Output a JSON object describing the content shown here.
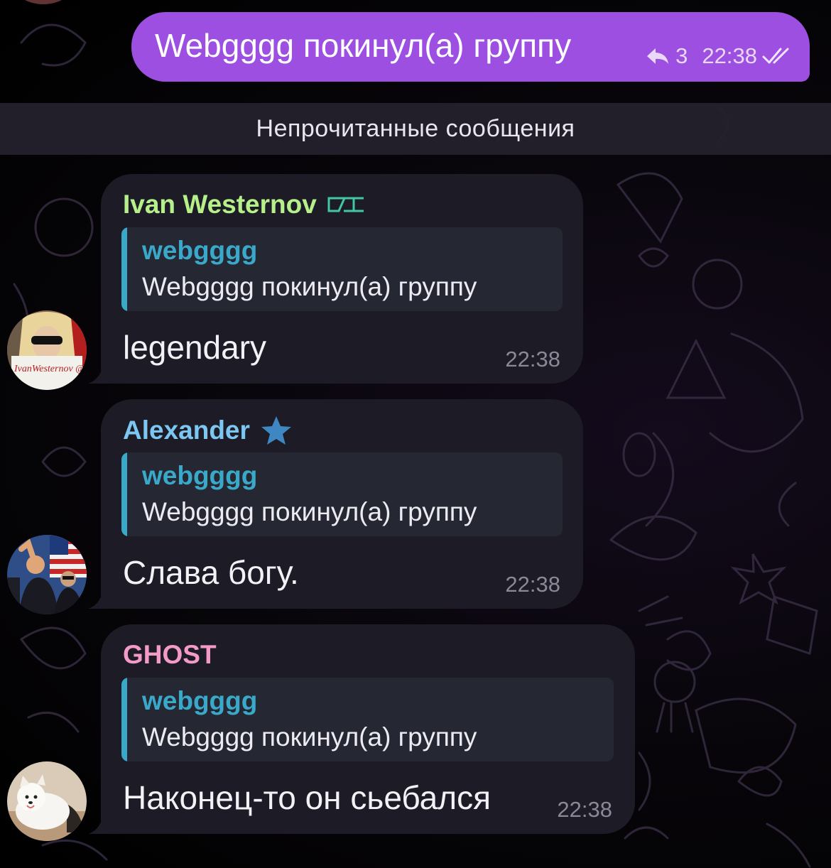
{
  "outgoing": {
    "text": "Webgggg покинул(а) группу",
    "reply_count": "3",
    "time": "22:38",
    "status_icon": "double-check-icon",
    "color": "#9c4fe0"
  },
  "unread_divider": "Непрочитанные сообщения",
  "messages": [
    {
      "sender": "Ivan Westernov",
      "sender_color": "#b5f08b",
      "emoji_status": "tag-icon",
      "quote_name": "webgggg",
      "quote_text": "Webgggg покинул(а) группу",
      "text": "legendary",
      "time": "22:38",
      "avatar_caption": "IvanWesternov @zelon"
    },
    {
      "sender": "Alexander",
      "sender_color": "#7cc6f2",
      "emoji_status": "star-icon",
      "quote_name": "webgggg",
      "quote_text": "Webgggg покинул(а) группу",
      "text": "Слава богу.",
      "time": "22:38"
    },
    {
      "sender": "GHOST",
      "sender_color": "#f49ac8",
      "quote_name": "webgggg",
      "quote_text": "Webgggg покинул(а) группу",
      "text": "Наконец-то он сьебался",
      "time": "22:38"
    }
  ]
}
